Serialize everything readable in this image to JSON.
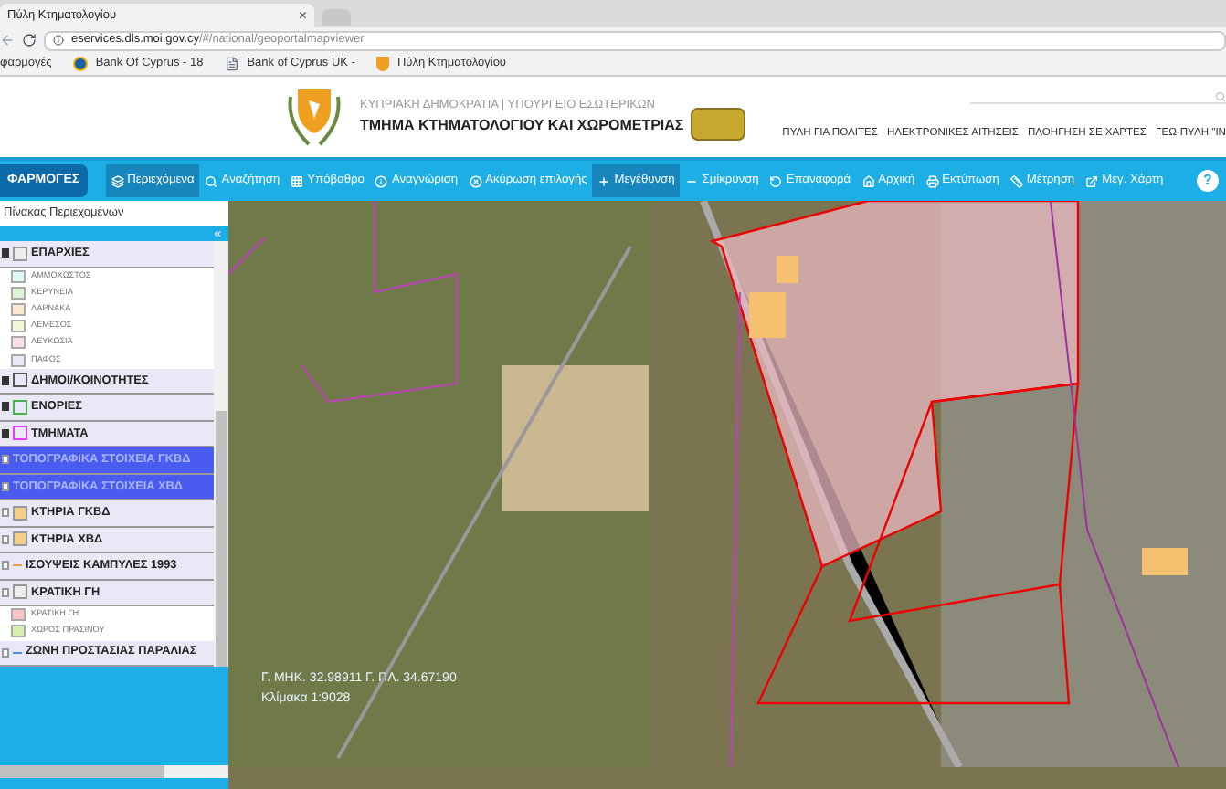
{
  "browser": {
    "tab_title": "Πύλη Κτηματολογίου",
    "tab_close": "×",
    "url_host": "eservices.dls.moi.gov.cy",
    "url_path": "/#/national/geoportalmapviewer",
    "bookmarks": [
      {
        "kind": "apps",
        "label": "φαρμογές"
      },
      {
        "kind": "bank",
        "label": "Bank Of Cyprus - 18"
      },
      {
        "kind": "page",
        "label": "Bank of Cyprus UK -"
      },
      {
        "kind": "site",
        "label": "Πύλη Κτηματολογίου"
      }
    ]
  },
  "header": {
    "ministry": "ΚΥΠΡΙΑΚΗ ΔΗΜΟΚΡΑΤΙΑ | ΥΠΟΥΡΓΕΙΟ ΕΣΩΤΕΡΙΚΩΝ",
    "department": "ΤΜΗΜΑ ΚΤΗΜΑΤΟΛΟΓΙΟΥ ΚΑΙ ΧΩΡΟΜΕΤΡΙΑΣ",
    "nav": [
      "ΠΥΛΗ ΓΙΑ ΠΟΛΙΤΕΣ",
      "ΗΛΕΚΤΡΟΝΙΚΕΣ ΑΙΤΗΣΕΙΣ",
      "ΠΛΟΗΓΗΣΗ ΣΕ ΧΑΡΤΕΣ",
      "ΓΕΩ-ΠΥΛΗ \"ΙΝ"
    ]
  },
  "toolbar": {
    "apps_button": "ΦΑΡΜΟΓΕΣ",
    "help": "?",
    "tools": [
      {
        "label": "Περιεχόμενα",
        "selected": true
      },
      {
        "label": "Αναζήτηση",
        "selected": false
      },
      {
        "label": "Υπόβαθρο",
        "selected": false
      },
      {
        "label": "Αναγνώριση",
        "selected": false
      },
      {
        "label": "Ακύρωση επιλογής",
        "selected": false
      },
      {
        "label": "Μεγέθυνση",
        "selected": true
      },
      {
        "label": "Σμίκρυνση",
        "selected": false
      },
      {
        "label": "Επαναφορά",
        "selected": false
      },
      {
        "label": "Αρχική",
        "selected": false
      },
      {
        "label": "Εκτύπωση",
        "selected": false
      },
      {
        "label": "Μέτρηση",
        "selected": false
      },
      {
        "label": "Μεγ. Χάρτη",
        "selected": false
      }
    ]
  },
  "sidebar": {
    "title": "Πίνακας Περιεχομένων",
    "collapse": "«",
    "layers": [
      {
        "kind": "fill",
        "label": "ΕΠΑΡΧΙΕΣ",
        "checked": true,
        "selected": false,
        "color": "#eeeeee",
        "children": [
          {
            "label": "ΑΜΜΟΧΩΣΤΟΣ",
            "color": "#def7f7"
          },
          {
            "label": "ΚΕΡΥΝΕΙΑ",
            "color": "#dcf5d6"
          },
          {
            "label": "ΛΑΡΝΑΚΑ",
            "color": "#fde6d2"
          },
          {
            "label": "ΛΕΜΕΣΟΣ",
            "color": "#f1f7d8"
          },
          {
            "label": "ΛΕΥΚΩΣΙΑ",
            "color": "#fbdde4"
          },
          {
            "label": "ΠΑΦΟΣ",
            "color": "#ebe6f8"
          }
        ]
      },
      {
        "kind": "outline",
        "label": "ΔΗΜΟΙ/ΚΟΙΝΟΤΗΤΕΣ",
        "checked": true,
        "selected": false,
        "color": "#555555"
      },
      {
        "kind": "outline",
        "label": "ΕΝΟΡΙΕΣ",
        "checked": true,
        "selected": false,
        "color": "#4caf50"
      },
      {
        "kind": "outline",
        "label": "ΤΜΗΜΑΤΑ",
        "checked": true,
        "selected": false,
        "color": "#e040fb"
      },
      {
        "kind": "none",
        "label": "ΤΟΠΟΓΡΑΦΙΚΑ ΣΤΟΙΧΕΙΑ ΓΚΒΔ",
        "checked": false,
        "selected": true
      },
      {
        "kind": "none",
        "label": "ΤΟΠΟΓΡΑΦΙΚΑ ΣΤΟΙΧΕΙΑ ΧΒΔ",
        "checked": false,
        "selected": true
      },
      {
        "kind": "fill",
        "label": "ΚΤΗΡΙΑ ΓΚΒΔ",
        "checked": false,
        "selected": false,
        "color": "#f5cf8a"
      },
      {
        "kind": "fill",
        "label": "ΚΤΗΡΙΑ ΧΒΔ",
        "checked": false,
        "selected": false,
        "color": "#f5cf8a"
      },
      {
        "kind": "line",
        "label": "ΙΣΟΥΨΕΙΣ ΚΑΜΠΥΛΕΣ 1993",
        "checked": false,
        "selected": false,
        "color": "#e8a040"
      },
      {
        "kind": "fill",
        "label": "ΚΡΑΤΙΚΗ ΓΗ",
        "checked": false,
        "selected": false,
        "color": "#eeeeee",
        "children": [
          {
            "label": "ΚΡΑΤΙΚΗ ΓΗ",
            "color": "#f8c4c4"
          },
          {
            "label": "ΧΩΡΟΣ ΠΡΑΣΙΝΟΥ",
            "color": "#d6f0ae"
          }
        ]
      },
      {
        "kind": "line",
        "label": "ΖΩΝΗ ΠΡΟΣΤΑΣΙΑΣ ΠΑΡΑΛΙΑΣ",
        "checked": false,
        "selected": false,
        "color": "#4a90d9"
      }
    ]
  },
  "map": {
    "coordinates": "Γ. ΜΗΚ. 32.98911 Γ. ΠΛ. 34.67190",
    "scale": "Κλίμακα 1:9028"
  }
}
